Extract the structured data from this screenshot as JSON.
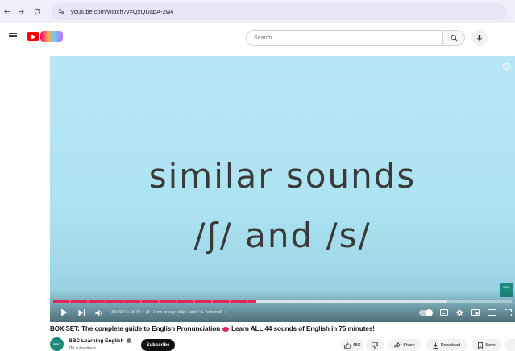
{
  "browser": {
    "back_icon": "back-arrow-icon",
    "forward_icon": "forward-arrow-icon",
    "reload_icon": "reload-icon",
    "url": "youtube.com/watch?v=QxQUapA-2w4"
  },
  "header": {
    "search_placeholder": "Search"
  },
  "video": {
    "line1": "similar sounds",
    "line2": "/ʃ/ and /s/",
    "time": "33:33 / 1:15:42",
    "chapter": "• /ʃ/ · How to say 'ship', 'sure' & 'national'",
    "chapter_chevron": "›",
    "progress_fraction": 0.443,
    "buffer_fraction": 0.86,
    "corner_badge": "BBC"
  },
  "below": {
    "title_part1": "BOX SET: The complete guide to English Pronunciation",
    "title_part2": "Learn ALL 44 sounds of English in 75 minutes!",
    "channel_avatar_text": "BBC",
    "channel_name": "BBC Learning English",
    "subscribers": "7M subscribers",
    "subscribe_label": "Subscribe",
    "like_count": "48K",
    "share_label": "Share",
    "download_label": "Download",
    "save_label": "Save",
    "more_label": "···"
  },
  "colors": {
    "youtube_red": "#ff0000",
    "progress_red": "#e0245e",
    "player_bg": "#b9e7f6"
  }
}
